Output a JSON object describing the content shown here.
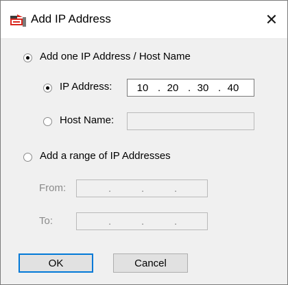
{
  "window": {
    "title": "Add IP Address",
    "close_glyph": "✕"
  },
  "options": {
    "single": {
      "label": "Add one IP Address / Host Name",
      "ip_label": "IP Address:",
      "ip_octets": [
        "10",
        "20",
        "30",
        "40"
      ],
      "host_label": "Host Name:",
      "host_value": ""
    },
    "range": {
      "label": "Add a range of IP Addresses",
      "from_label": "From:",
      "to_label": "To:"
    }
  },
  "buttons": {
    "ok": "OK",
    "cancel": "Cancel"
  },
  "colors": {
    "accent": "#0078d7",
    "icon_red": "#d9261c"
  },
  "icons": {
    "app": "network-card-icon",
    "close": "close-icon"
  }
}
